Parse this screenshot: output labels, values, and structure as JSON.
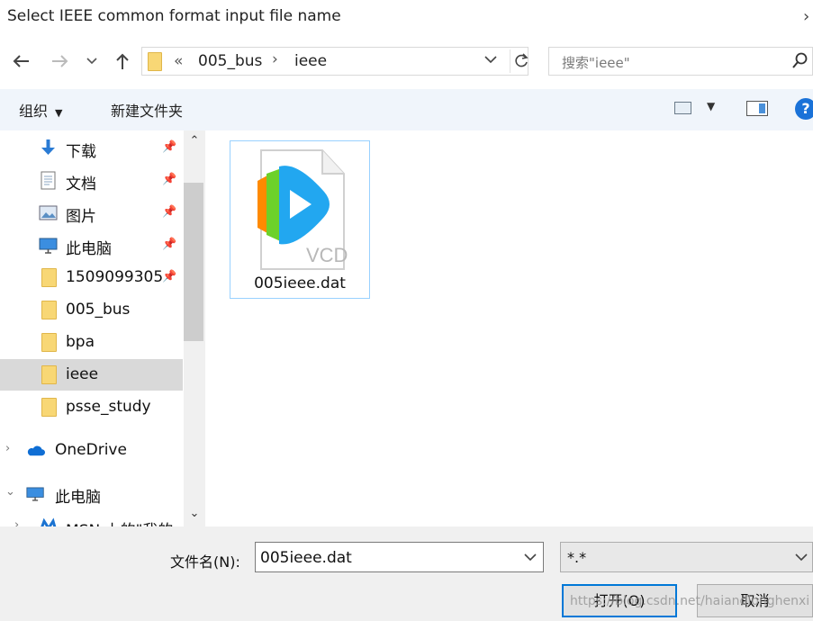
{
  "window": {
    "title": "Select IEEE common format input file name"
  },
  "address": {
    "overflow": "«",
    "crumbs": [
      "005_bus",
      "ieee"
    ],
    "separator": "›"
  },
  "search": {
    "placeholder": "搜索\"ieee\""
  },
  "toolbar": {
    "organize_label": "组织",
    "new_folder_label": "新建文件夹",
    "help_label": "?"
  },
  "nav": {
    "items": [
      {
        "label": "下载",
        "icon": "download-arrow-icon",
        "pinned": true
      },
      {
        "label": "文档",
        "icon": "document-icon",
        "pinned": true
      },
      {
        "label": "图片",
        "icon": "picture-icon",
        "pinned": true
      },
      {
        "label": "此电脑",
        "icon": "monitor-icon",
        "pinned": true
      },
      {
        "label": "1509099305",
        "icon": "folder-icon",
        "pinned": true
      },
      {
        "label": "005_bus",
        "icon": "folder-icon",
        "pinned": false
      },
      {
        "label": "bpa",
        "icon": "folder-icon",
        "pinned": false
      },
      {
        "label": "ieee",
        "icon": "folder-icon",
        "pinned": false,
        "selected": true
      },
      {
        "label": "psse_study",
        "icon": "folder-icon",
        "pinned": false
      },
      {
        "label": "OneDrive",
        "icon": "cloud-icon",
        "expander": "collapsed"
      },
      {
        "label": "此电脑",
        "icon": "monitor-icon",
        "expander": "expanded"
      },
      {
        "label": "MSN 上的\"我的",
        "icon": "msn-icon",
        "expander": "collapsed"
      }
    ]
  },
  "files": [
    {
      "name": "005ieee.dat",
      "icon": "vcd-media-file-icon",
      "badge": "VCD"
    }
  ],
  "bottom": {
    "filename_label": "文件名(N):",
    "filename_value": "005ieee.dat",
    "filetype_value": "*.*",
    "open_label": "打开(O)",
    "cancel_label": "取消"
  },
  "watermark": "https://blog.csdn.net/haiandlonghenxi",
  "colors": {
    "accent": "#0078d7",
    "selection": "#d9d9d9",
    "toolbar_bg": "#f0f5fb",
    "folder": "#f8d775"
  }
}
